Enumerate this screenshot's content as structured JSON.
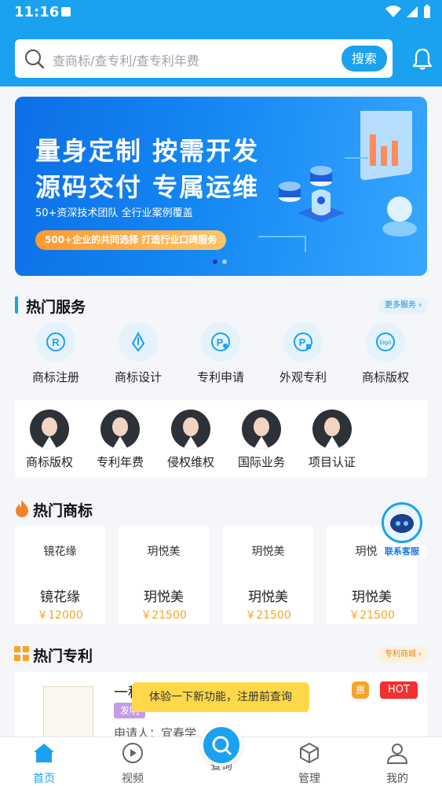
{
  "status": {
    "time": "11:16"
  },
  "search": {
    "placeholder": "查商标/查专利/查专利年费",
    "button_label": "搜索"
  },
  "banner": {
    "line1": "量身定制 按需开发",
    "line2": "源码交付 专属运维",
    "subtitle": "50+资深技术团队 全行业案例覆盖",
    "pill": "500+企业的共同选择 打造行业口碑服务",
    "page_count": 2,
    "active_page": 1
  },
  "hot_services": {
    "title": "热门服务",
    "more_label": "更多服务",
    "items": [
      {
        "label": "商标注册",
        "icon": "registered-trademark-icon"
      },
      {
        "label": "商标设计",
        "icon": "pen-nib-icon"
      },
      {
        "label": "专利申请",
        "icon": "patent-apply-icon"
      },
      {
        "label": "外观专利",
        "icon": "design-patent-icon"
      },
      {
        "label": "商标版权",
        "icon": "logo-copyright-icon"
      }
    ],
    "consultants": [
      {
        "label": "商标版权"
      },
      {
        "label": "专利年费"
      },
      {
        "label": "侵权维权"
      },
      {
        "label": "国际业务"
      },
      {
        "label": "项目认证"
      }
    ]
  },
  "hot_trademarks": {
    "title": "热门商标",
    "items": [
      {
        "image_text": "镜花缘",
        "name": "镜花缘",
        "price": "￥12000"
      },
      {
        "image_text": "玥悦美",
        "name": "玥悦美",
        "price": "￥21500"
      },
      {
        "image_text": "玥悦美",
        "name": "玥悦美",
        "price": "￥21500"
      },
      {
        "image_text": "玥悦美",
        "name": "玥悦美",
        "price": "￥21500"
      }
    ]
  },
  "customer_service": {
    "label": "联系客服"
  },
  "hot_patents": {
    "title": "热门专利",
    "more_label": "专利商城",
    "item": {
      "title": "一种",
      "tag": "发明",
      "applicant": "申请人：宜春学",
      "badge_discount": "惠",
      "badge_hot": "HOT"
    }
  },
  "tooltip": "体验一下新功能，注册前查询",
  "nav": {
    "items": [
      {
        "label": "首页",
        "icon": "home-icon",
        "active": true
      },
      {
        "label": "视频",
        "icon": "play-icon",
        "active": false
      },
      {
        "label": "查询",
        "icon": "search-icon",
        "active": false
      },
      {
        "label": "管理",
        "icon": "cube-icon",
        "active": false
      },
      {
        "label": "我的",
        "icon": "user-icon",
        "active": false
      }
    ]
  },
  "colors": {
    "primary": "#1aa1f0",
    "price": "#f5a623",
    "hot": "#f23030",
    "tooltip": "#ffd84a"
  }
}
